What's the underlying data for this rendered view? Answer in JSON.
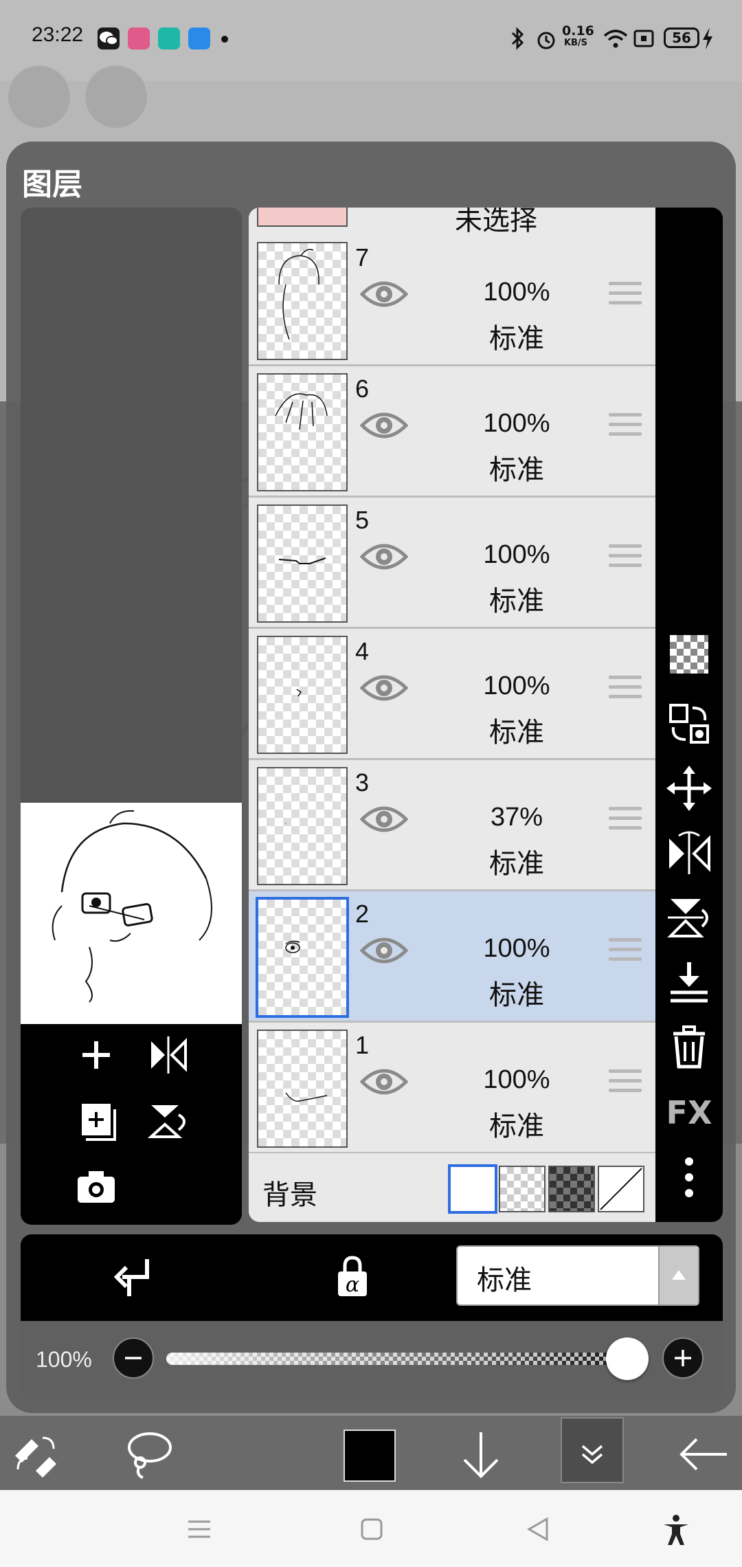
{
  "status_bar": {
    "time": "23:22",
    "net_speed_top": "0.16",
    "net_speed_unit": "KB/S",
    "battery": "56",
    "icons": [
      "wechat-icon",
      "bilibili-icon",
      "app-icon",
      "app-icon",
      "bluetooth-icon",
      "alarm-icon",
      "wifi-icon",
      "nfc-icon",
      "battery-icon",
      "charging-icon"
    ]
  },
  "panel": {
    "title": "图层",
    "partial_top_label": "未选择"
  },
  "layers": [
    {
      "num": "7",
      "opacity": "100%",
      "mode": "标准",
      "selected": false
    },
    {
      "num": "6",
      "opacity": "100%",
      "mode": "标准",
      "selected": false
    },
    {
      "num": "5",
      "opacity": "100%",
      "mode": "标准",
      "selected": false
    },
    {
      "num": "4",
      "opacity": "100%",
      "mode": "标准",
      "selected": false
    },
    {
      "num": "3",
      "opacity": "37%",
      "mode": "标准",
      "selected": false
    },
    {
      "num": "2",
      "opacity": "100%",
      "mode": "标准",
      "selected": true
    },
    {
      "num": "1",
      "opacity": "100%",
      "mode": "标准",
      "selected": false
    }
  ],
  "background_row": {
    "label": "背景"
  },
  "right_toolbar": {
    "fx_label": "FX",
    "icons": [
      "checker-icon",
      "transfer-icon",
      "move-icon",
      "flip-horizontal-icon",
      "flip-vertical-icon",
      "merge-down-icon",
      "trash-icon",
      "fx-icon",
      "more-icon"
    ]
  },
  "left_toolbar": {
    "icons": [
      "add-layer-icon",
      "flip-layer-icon",
      "add-copy-icon",
      "rotate-icon",
      "camera-icon"
    ]
  },
  "blend": {
    "mode_value": "标准"
  },
  "opacity_bar": {
    "value_label": "100%",
    "value": 1.0
  },
  "colors": {
    "selected_row": "#c9d7ec",
    "selection_border": "#2f6ee0",
    "toolbar_black": "#000000"
  }
}
